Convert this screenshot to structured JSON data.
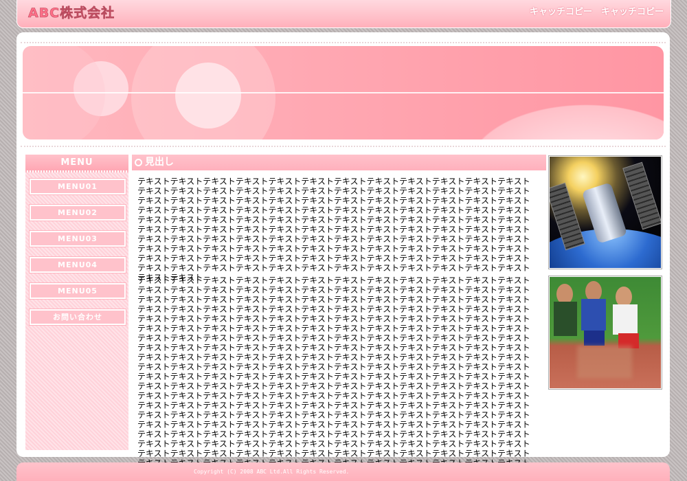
{
  "header": {
    "company_name": "ABC株式会社",
    "catchcopy": "キャッチコピー　キャッチコピー"
  },
  "sidebar": {
    "title": "MENU",
    "items": [
      {
        "label": "MENU01"
      },
      {
        "label": "MENU02"
      },
      {
        "label": "MENU03"
      },
      {
        "label": "MENU04"
      },
      {
        "label": "MENU05"
      },
      {
        "label": "お問い合わせ"
      }
    ]
  },
  "content": {
    "heading": "見出し",
    "paragraph_1": "テキストテキストテキストテキストテキストテキストテキストテキストテキストテキストテキストテキストテキストテキストテキストテキストテキストテキストテキストテキストテキストテキストテキストテキストテキストテキストテキストテキストテキストテキストテキストテキストテキストテキストテキストテキストテキストテキストテキストテキストテキストテキストテキストテキストテキストテキストテキストテキストテキストテキストテキストテキストテキストテキストテキストテキストテキストテキストテキストテキストテキストテキストテキストテキストテキストテキストテキストテキストテキストテキストテキストテキストテキストテキストテキストテキストテキストテキストテキストテキストテキストテキストテキストテキストテキストテキストテキストテキストテキストテキストテキストテキストテキストテキストテキストテキストテキストテキストテキストテキストテキストテキストテキストテキストテキストテキストテキストテキストテキストテキストテキストテキストテキストテキストテキストテキストテキストテキストテキストテキストテキストテキスト",
    "paragraph_2": "テキストテキストテキストテキストテキストテキストテキストテキストテキストテキストテキストテキストテキストテキストテキストテキストテキストテキストテキストテキストテキストテキストテキストテキストテキストテキストテキストテキストテキストテキストテキストテキストテキストテキストテキストテキストテキストテキストテキストテキストテキストテキストテキストテキストテキストテキストテキストテキストテキストテキストテキストテキストテキストテキストテキストテキストテキストテキストテキストテキストテキストテキストテキストテキストテキストテキストテキストテキストテキストテキストテキストテキストテキストテキストテキストテキストテキストテキストテキストテキストテキストテキストテキストテキストテキストテキストテキストテキストテキストテキストテキストテキストテキストテキストテキストテキストテキストテキストテキストテキストテキストテキストテキストテキストテキストテキストテキストテキストテキストテキストテキストテキストテキストテキストテキストテキストテキストテキストテキストテキストテキストテキストテキストテキストテキストテキストテキストテキストテキストテキストテキストテキストテキストテキストテキストテキストテキストテキストテキストテキストテキストテキストテキストテキストテキストテキストテキストテキストテキストテキストテキストテキストテキストテキストテキストテキストテキストテキストテキストテキストテキストテキストテキストテキストテキストテキストテキストテキストテキストテキストテキストテキストテキストテキストテキストテキストテキストテキストテキストテキストテキストテキストテキストテキストテキストテキストテキストテキストテキストテキストテキストテキストテキストテキストテキストテキストテキストテキストテキストテキストテキストテキストテキストテキストテキストテキストテキストテキストテキストテキストテキストテキストテキストテキストテキストテキストテキストテキストテキストテキストテキストテキストテキストテキストテキストテキストテキストテキストテキストテキストテキストテキストテキストテキストテキストテキストテキストテキストテキストテキストテキストテキストテキストテキストテキスト"
  },
  "footer": {
    "copyright": "Copyright (C) 2008 ABC Ltd.All Rights Reserved."
  },
  "colors": {
    "accent": "#ffb0bb",
    "accent_dark": "#ff6f88",
    "text": "#000000",
    "background": "#ffffff"
  }
}
